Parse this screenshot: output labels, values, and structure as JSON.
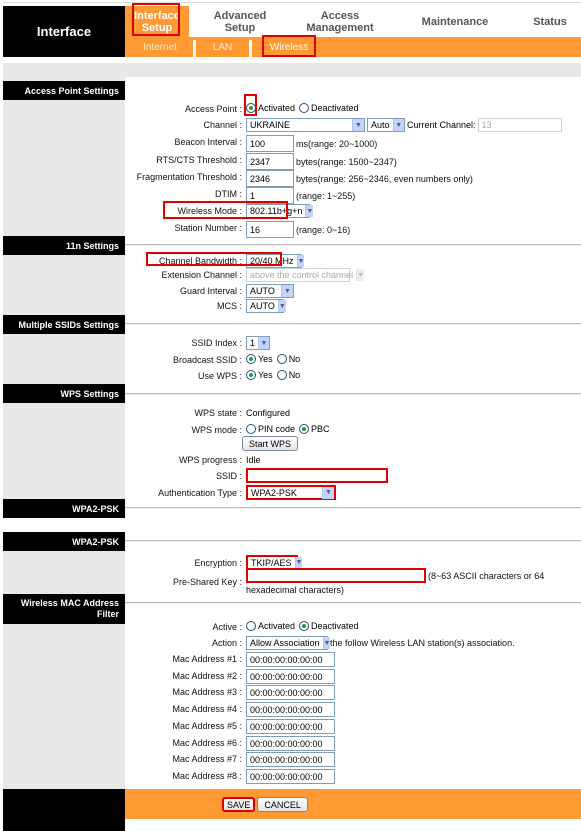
{
  "header": {
    "brand": "Interface",
    "nav": [
      {
        "label": "Interface Setup",
        "active": true
      },
      {
        "label": "Advanced Setup",
        "active": false
      },
      {
        "label": "Access Management",
        "active": false
      },
      {
        "label": "Maintenance",
        "active": false
      },
      {
        "label": "Status",
        "active": false
      }
    ],
    "subnav": [
      {
        "label": "Internet"
      },
      {
        "label": "LAN"
      },
      {
        "label": "Wireless",
        "active": true
      }
    ]
  },
  "sections": {
    "access_point": "Access Point Settings",
    "n11": "11n Settings",
    "multi_ssid": "Multiple SSIDs Settings",
    "wps": "WPS Settings",
    "wpa2_1": "WPA2-PSK",
    "wpa2_2": "WPA2-PSK",
    "mac_filter": "Wireless MAC Address Filter"
  },
  "access_point": {
    "access_point_label": "Access Point :",
    "activated": "Activated",
    "deactivated": "Deactivated",
    "access_point_value": "Activated",
    "channel_label": "Channel :",
    "channel_country": "UKRAINE",
    "channel_mode": "Auto",
    "current_channel_label": "Current Channel:",
    "current_channel": "13",
    "beacon_label": "Beacon Interval :",
    "beacon_value": "100",
    "beacon_hint": "ms(range: 20~1000)",
    "rts_label": "RTS/CTS Threshold :",
    "rts_value": "2347",
    "rts_hint": "bytes(range: 1500~2347)",
    "frag_label": "Fragmentation Threshold :",
    "frag_value": "2346",
    "frag_hint": "bytes(range: 256~2346, even numbers only)",
    "dtim_label": "DTIM :",
    "dtim_value": "1",
    "dtim_hint": "(range: 1~255)",
    "mode_label": "Wireless Mode :",
    "mode_value": "802.11b+g+n",
    "station_label": "Station Number :",
    "station_value": "16",
    "station_hint": "(range: 0~16)"
  },
  "n11": {
    "bw_label": "Channel Bandwidth :",
    "bw_value": "20/40 MHz",
    "ext_label": "Extension Channel :",
    "ext_value": "above the control channel",
    "gi_label": "Guard Interval :",
    "gi_value": "AUTO",
    "mcs_label": "MCS :",
    "mcs_value": "AUTO"
  },
  "multi_ssid": {
    "index_label": "SSID Index :",
    "index_value": "1",
    "broadcast_label": "Broadcast SSID :",
    "yes": "Yes",
    "no": "No",
    "broadcast_value": "Yes",
    "wps_label": "Use WPS :",
    "wps_value": "Yes"
  },
  "wps": {
    "state_label": "WPS state :",
    "state_value": "Configured",
    "mode_label": "WPS mode :",
    "pin": "PIN code",
    "pbc": "PBC",
    "mode_value": "PBC",
    "start_button": "Start WPS",
    "progress_label": "WPS progress :",
    "progress_value": "Idle",
    "ssid_label": "SSID :",
    "ssid_value": "",
    "auth_label": "Authentication Type :",
    "auth_value": "WPA2-PSK"
  },
  "wpa2": {
    "enc_label": "Encryption :",
    "enc_value": "TKIP/AES",
    "psk_label": "Pre-Shared Key :",
    "psk_value": "",
    "psk_hint_1": "(8~63 ASCII characters or 64",
    "psk_hint_2": "hexadecimal characters)"
  },
  "mac_filter": {
    "active_label": "Active :",
    "activated": "Activated",
    "deactivated": "Deactivated",
    "active_value": "Deactivated",
    "action_label": "Action :",
    "action_value": "Allow Association",
    "action_hint": "the follow Wireless LAN station(s) association.",
    "addresses": [
      {
        "label": "Mac Address #1 :",
        "value": "00:00:00:00:00:00"
      },
      {
        "label": "Mac Address #2 :",
        "value": "00:00:00:00:00:00"
      },
      {
        "label": "Mac Address #3 :",
        "value": "00:00:00:00:00:00"
      },
      {
        "label": "Mac Address #4 :",
        "value": "00:00:00:00:00:00"
      },
      {
        "label": "Mac Address #5 :",
        "value": "00:00:00:00:00:00"
      },
      {
        "label": "Mac Address #6 :",
        "value": "00:00:00:00:00:00"
      },
      {
        "label": "Mac Address #7 :",
        "value": "00:00:00:00:00:00"
      },
      {
        "label": "Mac Address #8 :",
        "value": "00:00:00:00:00:00"
      }
    ]
  },
  "footer": {
    "save": "SAVE",
    "cancel": "CANCEL"
  },
  "colors": {
    "accent": "#ff9933",
    "highlight": "#e00000"
  }
}
